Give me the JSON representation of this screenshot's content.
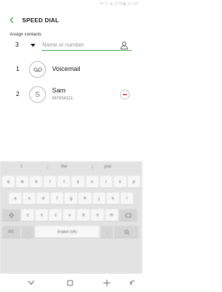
{
  "status_bar": {
    "text": "✉ ⚲ ▲ 57%▮ 11:30"
  },
  "header": {
    "title": "SPEED DIAL",
    "back_icon": "back-arrow-icon"
  },
  "assign": {
    "label": "Assign contacts",
    "selected_slot": "3",
    "input_placeholder": "Name or number",
    "input_value": ""
  },
  "speed_dial_entries": [
    {
      "index": "1",
      "avatar_icon": "voicemail-icon",
      "name": "Voicemail"
    },
    {
      "index": "2",
      "avatar_letter": "S",
      "name": "Sam",
      "number": "987654321",
      "action_icon": "remove-icon"
    }
  ],
  "keyboard": {
    "suggestions": [
      "t",
      "the",
      "you"
    ],
    "rows": [
      [
        "q",
        "w",
        "e",
        "r",
        "t",
        "y",
        "u",
        "i",
        "o",
        "p"
      ],
      [
        "a",
        "s",
        "d",
        "f",
        "g",
        "h",
        "j",
        "k",
        "l"
      ],
      [
        "z",
        "x",
        "c",
        "v",
        "b",
        "n",
        "m"
      ]
    ],
    "space_label": "English (UK)"
  },
  "nav_bar": {
    "icons": [
      "nav-down-icon",
      "recent-apps-icon",
      "home-icon",
      "back-icon"
    ]
  },
  "colors": {
    "accent": "#48a84c",
    "remove": "#d65b5b",
    "keyboard_bg": "#e3e3e3"
  }
}
